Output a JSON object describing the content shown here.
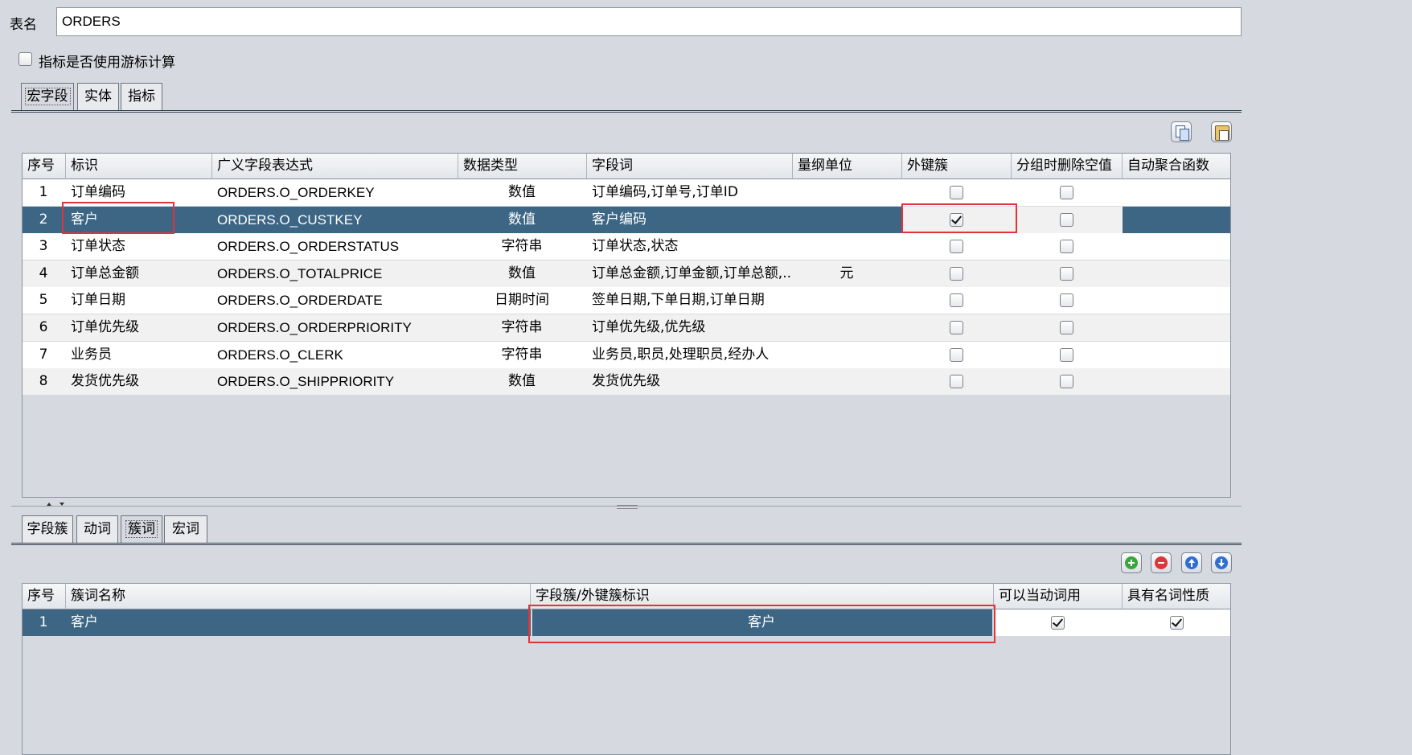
{
  "form": {
    "table_name_label": "表名",
    "table_name_value": "ORDERS",
    "cursor_checkbox_label": "指标是否使用游标计算",
    "cursor_checkbox_checked": false
  },
  "top_tabs": [
    {
      "label": "宏字段",
      "active": true
    },
    {
      "label": "实体",
      "active": false
    },
    {
      "label": "指标",
      "active": false
    }
  ],
  "top_toolbar": {
    "icons": [
      "copy-icon",
      "paste-icon"
    ]
  },
  "macro_table": {
    "columns": [
      "序号",
      "标识",
      "广义字段表达式",
      "数据类型",
      "字段词",
      "量纲单位",
      "外键簇",
      "分组时删除空值",
      "自动聚合函数"
    ],
    "rows": [
      {
        "no": "1",
        "id": "订单编码",
        "expr": "ORDERS.O_ORDERKEY",
        "type": "数值",
        "words": "订单编码,订单号,订单ID",
        "unit": "",
        "fk": false,
        "del_null": false,
        "agg": "",
        "selected": false
      },
      {
        "no": "2",
        "id": "客户",
        "expr": "ORDERS.O_CUSTKEY",
        "type": "数值",
        "words": "客户编码",
        "unit": "",
        "fk": true,
        "del_null": false,
        "agg": "",
        "selected": true
      },
      {
        "no": "3",
        "id": "订单状态",
        "expr": "ORDERS.O_ORDERSTATUS",
        "type": "字符串",
        "words": "订单状态,状态",
        "unit": "",
        "fk": false,
        "del_null": false,
        "agg": "",
        "selected": false
      },
      {
        "no": "4",
        "id": "订单总金额",
        "expr": "ORDERS.O_TOTALPRICE",
        "type": "数值",
        "words": "订单总金额,订单金额,订单总额,...",
        "unit": "元",
        "fk": false,
        "del_null": false,
        "agg": "",
        "selected": false
      },
      {
        "no": "5",
        "id": "订单日期",
        "expr": "ORDERS.O_ORDERDATE",
        "type": "日期时间",
        "words": "签单日期,下单日期,订单日期",
        "unit": "",
        "fk": false,
        "del_null": false,
        "agg": "",
        "selected": false
      },
      {
        "no": "6",
        "id": "订单优先级",
        "expr": "ORDERS.O_ORDERPRIORITY",
        "type": "字符串",
        "words": "订单优先级,优先级",
        "unit": "",
        "fk": false,
        "del_null": false,
        "agg": "",
        "selected": false
      },
      {
        "no": "7",
        "id": "业务员",
        "expr": "ORDERS.O_CLERK",
        "type": "字符串",
        "words": "业务员,职员,处理职员,经办人",
        "unit": "",
        "fk": false,
        "del_null": false,
        "agg": "",
        "selected": false
      },
      {
        "no": "8",
        "id": "发货优先级",
        "expr": "ORDERS.O_SHIPPRIORITY",
        "type": "数值",
        "words": "发货优先级",
        "unit": "",
        "fk": false,
        "del_null": false,
        "agg": "",
        "selected": false
      }
    ]
  },
  "bottom_tabs": [
    {
      "label": "字段簇",
      "active": false
    },
    {
      "label": "动词",
      "active": false
    },
    {
      "label": "簇词",
      "active": true
    },
    {
      "label": "宏词",
      "active": false
    }
  ],
  "bottom_toolbar": {
    "icons": [
      "add-icon",
      "remove-icon",
      "move-up-icon",
      "move-down-icon"
    ]
  },
  "cluster_table": {
    "columns": [
      "序号",
      "簇词名称",
      "字段簇/外键簇标识",
      "可以当动词用",
      "具有名词性质"
    ],
    "rows": [
      {
        "no": "1",
        "name": "客户",
        "cluster_id": "客户",
        "as_verb": true,
        "noun": true,
        "selected": true
      }
    ]
  },
  "colors": {
    "selection": "#3d6685",
    "highlight_box": "#e0333a",
    "background": "#d6d9df"
  }
}
